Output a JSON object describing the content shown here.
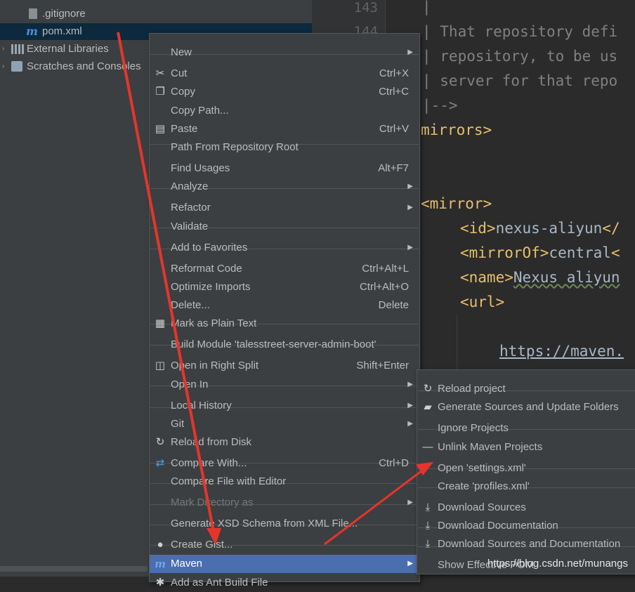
{
  "project_tree": {
    "items": [
      {
        "label": ".gitignore",
        "icon": "gitignore-file-icon"
      },
      {
        "label": "pom.xml",
        "icon": "maven-file-icon"
      },
      {
        "label": "External Libraries",
        "icon": "library-icon"
      },
      {
        "label": "Scratches and Consoles",
        "icon": "scratches-icon"
      }
    ]
  },
  "editor": {
    "line_numbers": [
      "143",
      "144"
    ],
    "code_lines": [
      {
        "cls": "cmt",
        "text": "|"
      },
      {
        "cls": "cmt",
        "text": "| That repository defi"
      },
      {
        "cls": "cmt",
        "text": "| repository, to be us"
      },
      {
        "cls": "cmt",
        "text": "| server for that repo"
      },
      {
        "cls": "cmt",
        "text": "|-->"
      },
      {
        "cls": "tag",
        "text": "mirrors>"
      },
      {
        "cls": "tag",
        "text": "<mirror>"
      },
      {
        "cls": "mix",
        "open": "<id>",
        "body": "nexus-aliyun",
        "close": "</"
      },
      {
        "cls": "mix",
        "open": "<mirrorOf>",
        "body": "central",
        "close": "<"
      },
      {
        "cls": "mix",
        "open": "<name>",
        "body": "Nexus aliyun",
        "close": ""
      },
      {
        "cls": "tag",
        "text": "<url>"
      },
      {
        "cls": "url",
        "text": "https://maven."
      }
    ]
  },
  "context_menu": {
    "items": [
      {
        "label": "New",
        "submenu": true
      },
      {
        "label": "Cut",
        "shortcut": "Ctrl+X",
        "icon": "scissors-icon"
      },
      {
        "label": "Copy",
        "shortcut": "Ctrl+C",
        "icon": "copy-icon"
      },
      {
        "label": "Copy Path..."
      },
      {
        "label": "Paste",
        "shortcut": "Ctrl+V",
        "icon": "paste-icon"
      },
      {
        "label": "Path From Repository Root"
      },
      {
        "label": "Find Usages",
        "shortcut": "Alt+F7"
      },
      {
        "label": "Analyze",
        "submenu": true
      },
      {
        "label": "Refactor",
        "submenu": true
      },
      {
        "label": "Validate"
      },
      {
        "label": "Add to Favorites",
        "submenu": true
      },
      {
        "label": "Reformat Code",
        "shortcut": "Ctrl+Alt+L"
      },
      {
        "label": "Optimize Imports",
        "shortcut": "Ctrl+Alt+O"
      },
      {
        "label": "Delete...",
        "shortcut": "Delete"
      },
      {
        "label": "Mark as Plain Text",
        "icon": "plain-text-icon"
      },
      {
        "label": "Build Module 'talesstreet-server-admin-boot'"
      },
      {
        "label": "Open in Right Split",
        "shortcut": "Shift+Enter",
        "icon": "split-icon"
      },
      {
        "label": "Open In",
        "submenu": true
      },
      {
        "label": "Local History",
        "submenu": true
      },
      {
        "label": "Git",
        "submenu": true
      },
      {
        "label": "Reload from Disk",
        "icon": "reload-icon"
      },
      {
        "label": "Compare With...",
        "shortcut": "Ctrl+D",
        "icon": "compare-icon"
      },
      {
        "label": "Compare File with Editor"
      },
      {
        "label": "Mark Directory as",
        "submenu": true,
        "disabled": true
      },
      {
        "label": "Generate XSD Schema from XML File..."
      },
      {
        "label": "Create Gist...",
        "icon": "github-icon"
      },
      {
        "label": "Maven",
        "submenu": true,
        "icon": "maven-icon",
        "highlighted": true
      },
      {
        "label": "Add as Ant Build File",
        "icon": "ant-icon"
      }
    ]
  },
  "maven_submenu": {
    "items": [
      {
        "label": "Reload project",
        "icon": "reload-icon"
      },
      {
        "label": "Generate Sources and Update Folders",
        "icon": "folder-refresh-icon"
      },
      {
        "label": "Ignore Projects"
      },
      {
        "label": "Unlink Maven Projects",
        "icon": "minus-icon"
      },
      {
        "label": "Open 'settings.xml'"
      },
      {
        "label": "Create 'profiles.xml'"
      },
      {
        "label": "Download Sources",
        "icon": "download-icon"
      },
      {
        "label": "Download Documentation",
        "icon": "download-icon"
      },
      {
        "label": "Download Sources and Documentation",
        "icon": "download-icon"
      },
      {
        "label": "Show Effective POM"
      }
    ]
  },
  "watermark": "https://blog.csdn.net/munangs",
  "colors": {
    "highlight": "#4b6eaf",
    "annotation_arrow": "#e5352b",
    "tag": "#e8bf6a"
  }
}
